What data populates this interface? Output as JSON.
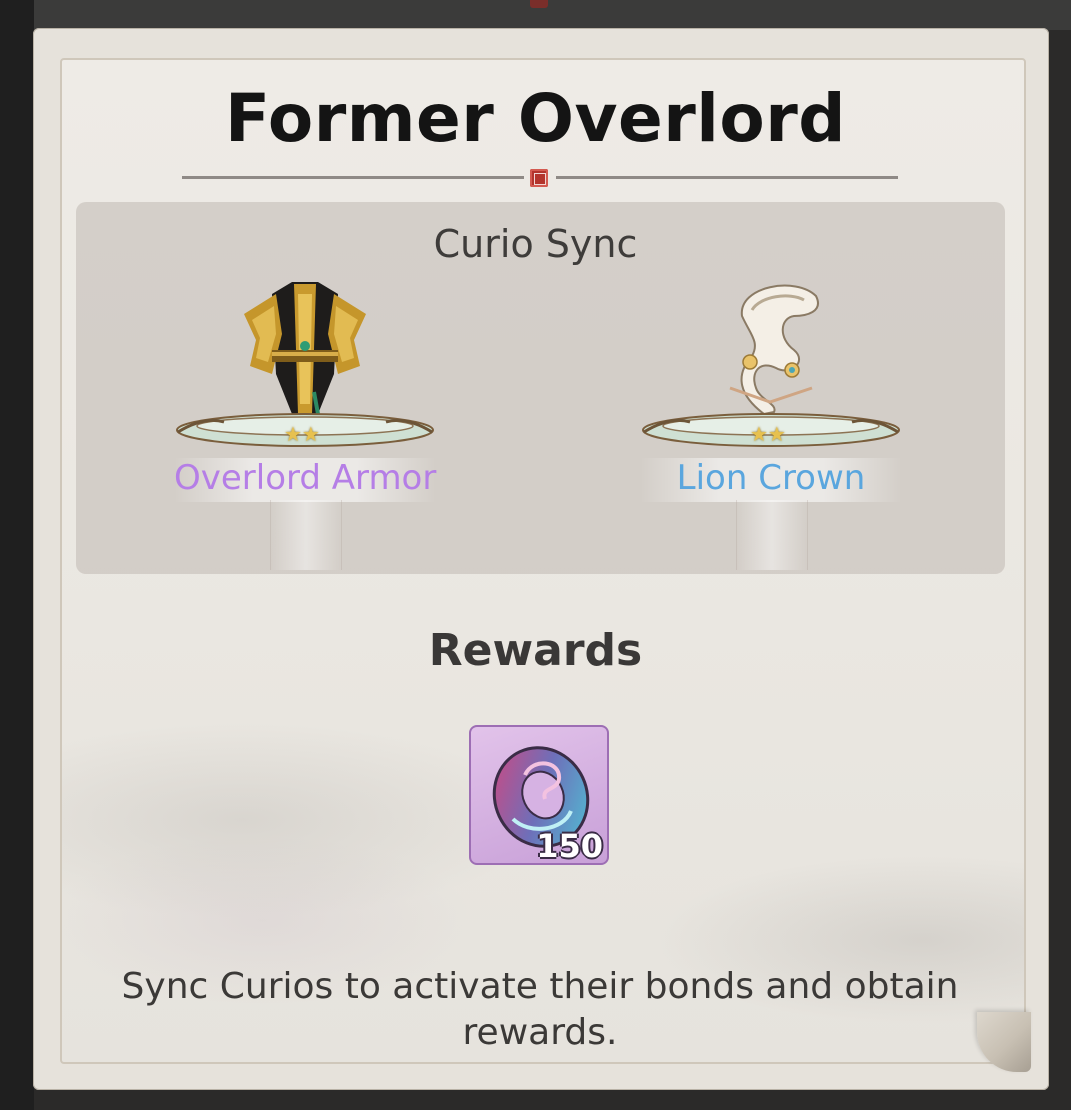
{
  "dialog": {
    "title": "Former Overlord"
  },
  "curio_sync": {
    "heading": "Curio Sync",
    "items": [
      {
        "name": "Overlord Armor",
        "stars": 2,
        "name_color": "#b57ee6",
        "icon": "armor-icon"
      },
      {
        "name": "Lion Crown",
        "stars": 2,
        "name_color": "#5aa6de",
        "icon": "crown-icon"
      }
    ]
  },
  "rewards": {
    "heading": "Rewards",
    "items": [
      {
        "icon": "ring-token-icon",
        "quantity": "150"
      }
    ]
  },
  "hint": "Sync Curios to activate their bonds and obtain rewards.",
  "colors": {
    "seal": "#b3342c",
    "star": "#e7c14f",
    "reward_tile": "#d6b2e3"
  }
}
